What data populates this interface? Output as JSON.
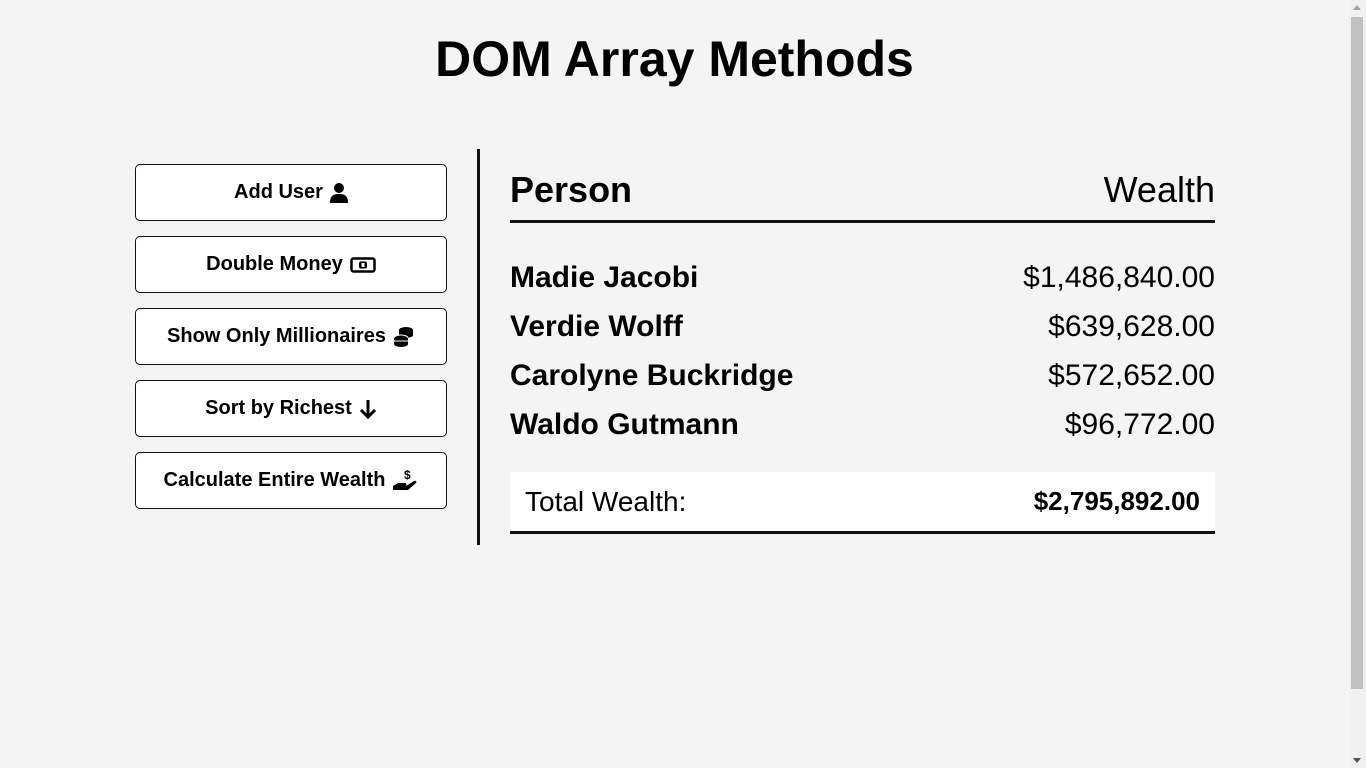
{
  "title": "DOM Array Methods",
  "buttons": [
    {
      "label": "Add User",
      "icon": "user-icon"
    },
    {
      "label": "Double Money",
      "icon": "money-bill-icon"
    },
    {
      "label": "Show Only Millionaires",
      "icon": "coins-icon"
    },
    {
      "label": "Sort by Richest",
      "icon": "arrow-down-icon"
    },
    {
      "label": "Calculate Entire Wealth",
      "icon": "hand-holding-dollar-icon"
    }
  ],
  "table": {
    "person_header": "Person",
    "wealth_header": "Wealth",
    "rows": [
      {
        "name": "Madie Jacobi",
        "wealth": "$1,486,840.00"
      },
      {
        "name": "Verdie Wolff",
        "wealth": "$639,628.00"
      },
      {
        "name": "Carolyne Buckridge",
        "wealth": "$572,652.00"
      },
      {
        "name": "Waldo Gutmann",
        "wealth": "$96,772.00"
      }
    ],
    "total_label": "Total Wealth:",
    "total_value": "$2,795,892.00"
  }
}
